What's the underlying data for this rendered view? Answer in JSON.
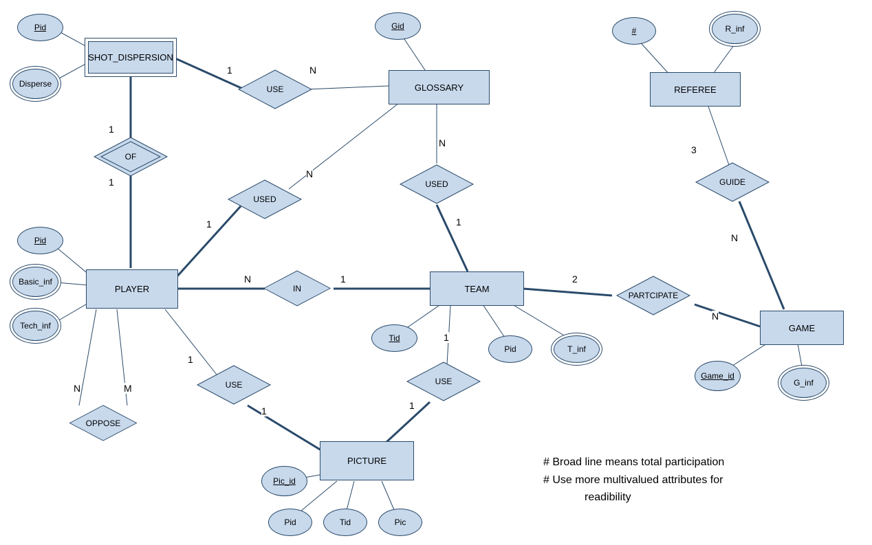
{
  "chart_data": {
    "type": "er-diagram",
    "entities": [
      {
        "name": "SHOT_DISPERSION",
        "weak": true,
        "attrs": [
          {
            "name": "Pid",
            "key": true
          },
          {
            "name": "Disperse",
            "multivalued": true
          }
        ]
      },
      {
        "name": "GLOSSARY",
        "attrs": [
          {
            "name": "Gid",
            "key": true
          }
        ]
      },
      {
        "name": "REFEREE",
        "attrs": [
          {
            "name": "#",
            "key": true
          },
          {
            "name": "R_inf",
            "multivalued": true
          }
        ]
      },
      {
        "name": "PLAYER",
        "attrs": [
          {
            "name": "Pid",
            "key": true
          },
          {
            "name": "Basic_inf",
            "multivalued": true
          },
          {
            "name": "Tech_inf",
            "multivalued": true
          }
        ]
      },
      {
        "name": "TEAM",
        "attrs": [
          {
            "name": "Tid",
            "key": true
          },
          {
            "name": "Pid"
          },
          {
            "name": "T_inf",
            "multivalued": true
          }
        ]
      },
      {
        "name": "GAME",
        "attrs": [
          {
            "name": "Game_id",
            "key": true
          },
          {
            "name": "G_inf",
            "multivalued": true
          }
        ]
      },
      {
        "name": "PICTURE",
        "attrs": [
          {
            "name": "Pic_id",
            "key": true
          },
          {
            "name": "Pid"
          },
          {
            "name": "Tid"
          },
          {
            "name": "Pic"
          }
        ]
      }
    ],
    "relationships": [
      {
        "name": "USE",
        "between": [
          "SHOT_DISPERSION",
          "GLOSSARY"
        ],
        "card": [
          "1",
          "N"
        ],
        "total": [
          "SHOT_DISPERSION"
        ]
      },
      {
        "name": "OF",
        "weak": true,
        "between": [
          "SHOT_DISPERSION",
          "PLAYER"
        ],
        "card": [
          "1",
          "1"
        ],
        "total": [
          "SHOT_DISPERSION",
          "PLAYER"
        ]
      },
      {
        "name": "USED",
        "between": [
          "PLAYER",
          "GLOSSARY"
        ],
        "card": [
          "1",
          "N"
        ],
        "total": [
          "PLAYER"
        ]
      },
      {
        "name": "USED",
        "between": [
          "TEAM",
          "GLOSSARY"
        ],
        "card": [
          "1",
          "N"
        ],
        "total": [
          "TEAM"
        ]
      },
      {
        "name": "IN",
        "between": [
          "PLAYER",
          "TEAM"
        ],
        "card": [
          "N",
          "1"
        ],
        "total": [
          "PLAYER",
          "TEAM"
        ]
      },
      {
        "name": "OPPOSE",
        "between": [
          "PLAYER",
          "PLAYER"
        ],
        "card": [
          "N",
          "M"
        ],
        "total": []
      },
      {
        "name": "USE",
        "between": [
          "PLAYER",
          "PICTURE"
        ],
        "card": [
          "1",
          "1"
        ],
        "total": [
          "PICTURE"
        ]
      },
      {
        "name": "USE",
        "between": [
          "TEAM",
          "PICTURE"
        ],
        "card": [
          "1",
          "1"
        ],
        "total": [
          "PICTURE"
        ]
      },
      {
        "name": "PARTCIPATE",
        "between": [
          "TEAM",
          "GAME"
        ],
        "card": [
          "2",
          "N"
        ],
        "total": [
          "TEAM",
          "GAME"
        ]
      },
      {
        "name": "GUIDE",
        "between": [
          "REFEREE",
          "GAME"
        ],
        "card": [
          "3",
          "N"
        ],
        "total": [
          "GAME"
        ]
      }
    ],
    "notes": [
      "# Broad line means  total participation",
      "# Use more multivalued attributes for readibility"
    ]
  },
  "entities": {
    "shot_dispersion": "SHOT_DISPERSION",
    "glossary": "GLOSSARY",
    "referee": "REFEREE",
    "player": "PLAYER",
    "team": "TEAM",
    "game": "GAME",
    "picture": "PICTURE"
  },
  "rel": {
    "use1": "USE",
    "of": "OF",
    "used1": "USED",
    "used2": "USED",
    "in": "IN",
    "oppose": "OPPOSE",
    "use2": "USE",
    "use3": "USE",
    "participate": "PARTCIPATE",
    "guide": "GUIDE"
  },
  "attr": {
    "sd_pid": "Pid",
    "sd_disperse": "Disperse",
    "g_gid": "Gid",
    "r_hash": "#",
    "r_inf": "R_inf",
    "p_pid": "Pid",
    "p_basic": "Basic_inf",
    "p_tech": "Tech_inf",
    "t_tid": "Tid",
    "t_pid": "Pid",
    "t_inf": "T_inf",
    "gm_id": "Game_id",
    "gm_inf": "G_inf",
    "pic_id": "Pic_id",
    "pic_pid": "Pid",
    "pic_tid": "Tid",
    "pic_pic": "Pic"
  },
  "card": {
    "use1_l": "1",
    "use1_r": "N",
    "of_t": "1",
    "of_b": "1",
    "used1_l": "1",
    "used1_r": "N",
    "used2_t": "N",
    "used2_b": "1",
    "in_l": "N",
    "in_r": "1",
    "oppose_l": "N",
    "oppose_r": "M",
    "use2_t": "1",
    "use2_b": "1",
    "use3_t": "1",
    "use3_b": "1",
    "part_l": "2",
    "part_r": "N",
    "guide_t": "3",
    "guide_b": "N"
  },
  "notes": {
    "l1": "# Broad line means  total participation",
    "l2": "# Use more multivalued attributes for",
    "l3": "readibility"
  }
}
